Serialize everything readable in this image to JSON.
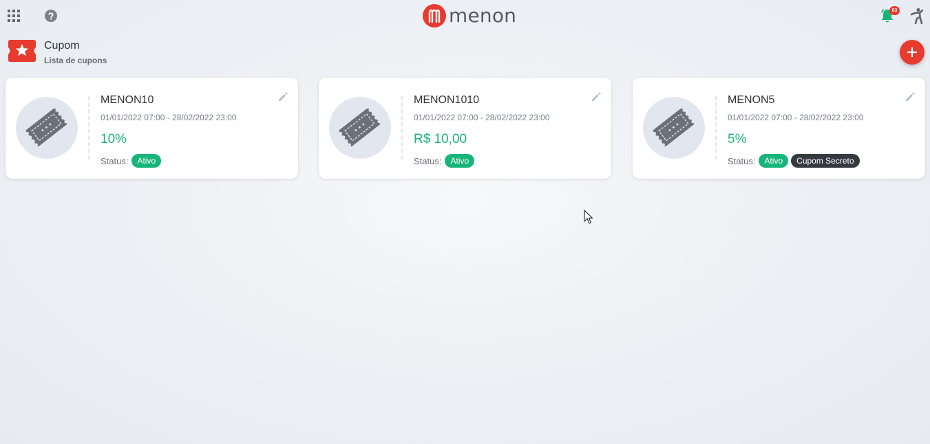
{
  "header": {
    "logo_text": "menon",
    "notification_count": "03",
    "icons": {
      "apps": "apps-grid-icon",
      "help": "help-icon",
      "bell": "bell-icon",
      "user": "user-icon"
    },
    "colors": {
      "brand": "#e63b2e",
      "bell": "#18b57a"
    }
  },
  "page": {
    "title": "Cupom",
    "subtitle": "Lista de cupons",
    "icon": "coupon-star-icon"
  },
  "coupons": [
    {
      "code": "MENON10",
      "period": "01/01/2022 07:00 - 28/02/2022 23:00",
      "value": "10%",
      "status_label": "Status:",
      "badges": [
        "Ativo"
      ]
    },
    {
      "code": "MENON1010",
      "period": "01/01/2022 07:00 - 28/02/2022 23:00",
      "value": "R$ 10,00",
      "status_label": "Status:",
      "badges": [
        "Ativo"
      ]
    },
    {
      "code": "MENON5",
      "period": "01/01/2022 07:00 - 28/02/2022 23:00",
      "value": "5%",
      "status_label": "Status:",
      "badges": [
        "Ativo",
        "Cupom Secreto"
      ]
    }
  ],
  "colors": {
    "active_badge": "#18b57a",
    "secret_badge": "#343a40",
    "value_text": "#18b57a"
  }
}
